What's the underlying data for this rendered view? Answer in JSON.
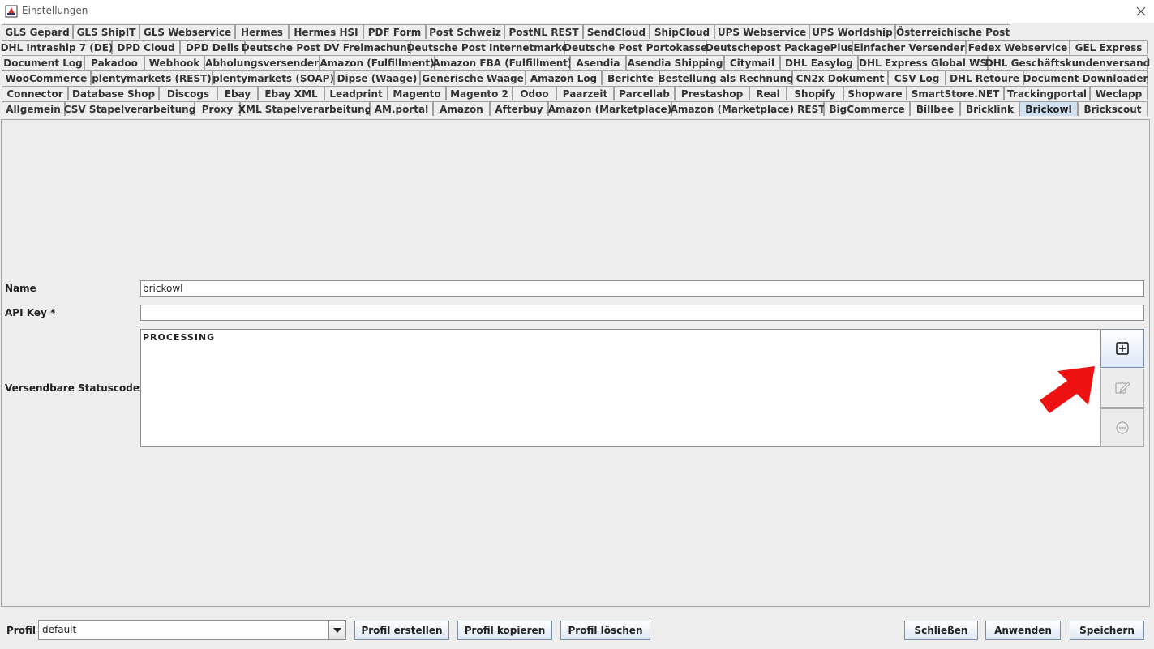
{
  "window": {
    "title": "Einstellungen"
  },
  "tab_rows": [
    [
      "GLS Gepard",
      "GLS ShipIT",
      "GLS Webservice",
      "Hermes",
      "Hermes HSI",
      "PDF Form",
      "Post Schweiz",
      "PostNL REST",
      "SendCloud",
      "ShipCloud",
      "UPS Webservice",
      "UPS Worldship",
      "Österreichische Post"
    ],
    [
      "DHL Intraship 7 (DE)",
      "DPD Cloud",
      "DPD Delis",
      "Deutsche Post DV Freimachung",
      "Deutsche Post Internetmarke",
      "Deutsche Post Portokasse",
      "Deutschepost PackagePlus",
      "Einfacher Versender",
      "Fedex Webservice",
      "GEL Express"
    ],
    [
      "Document Log",
      "Pakadoo",
      "Webhook",
      "Abholungsversender",
      "Amazon (Fulfillment)",
      "Amazon FBA (Fulfillment)",
      "Asendia",
      "Asendia Shipping",
      "Citymail",
      "DHL Easylog",
      "DHL Express Global WS",
      "DHL Geschäftskundenversand"
    ],
    [
      "WooCommerce",
      "plentymarkets (REST)",
      "plentymarkets (SOAP)",
      "Dipse (Waage)",
      "Generische Waage",
      "Amazon Log",
      "Berichte",
      "Bestellung als Rechnung",
      "CN2x Dokument",
      "CSV Log",
      "DHL Retoure",
      "Document Downloader"
    ],
    [
      "Connector",
      "Database Shop",
      "Discogs",
      "Ebay",
      "Ebay XML",
      "Leadprint",
      "Magento",
      "Magento 2",
      "Odoo",
      "Paarzeit",
      "Parcellab",
      "Prestashop",
      "Real",
      "Shopify",
      "Shopware",
      "SmartStore.NET",
      "Trackingportal",
      "Weclapp"
    ],
    [
      "Allgemein",
      "CSV Stapelverarbeitung",
      "Proxy",
      "XML Stapelverarbeitung",
      "AM.portal",
      "Amazon",
      "Afterbuy",
      "Amazon (Marketplace)",
      "Amazon (Marketplace) REST",
      "BigCommerce",
      "Billbee",
      "Bricklink",
      "Brickowl",
      "Brickscout"
    ]
  ],
  "active_tab": "Brickowl",
  "form": {
    "name_label": "Name",
    "name_value": "brickowl",
    "apikey_label": "API Key *",
    "apikey_value": "",
    "status_label": "Versendbare Statuscodes *",
    "status_items": [
      "PROCESSING"
    ]
  },
  "icons": {
    "add": "plus-square-icon",
    "edit": "edit-pencil-icon",
    "remove": "minus-circle-icon",
    "annotation": "red-arrow-icon",
    "app": "app-icon",
    "close": "close-icon",
    "dropdown": "chevron-down-icon"
  },
  "colors": {
    "annotation_arrow": "#ee1111",
    "active_tab": "#cfe0f3"
  },
  "footer": {
    "profile_label": "Profil",
    "profile_value": "default",
    "buttons": {
      "create": "Profil erstellen",
      "copy": "Profil kopieren",
      "delete": "Profil löschen",
      "close": "Schließen",
      "apply": "Anwenden",
      "save": "Speichern"
    }
  }
}
